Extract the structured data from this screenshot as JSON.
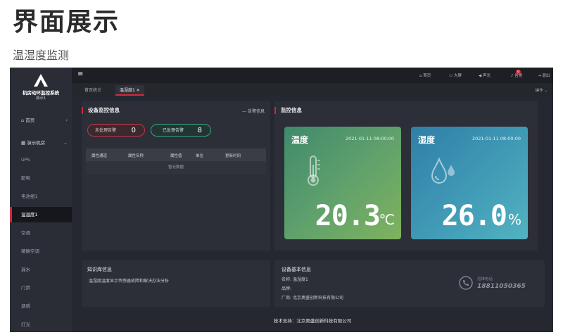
{
  "slide": {
    "title": "界面展示",
    "subtitle": "温湿度监测"
  },
  "app": {
    "name": "机房动环监控系统",
    "version": "演示1",
    "sidebar": [
      {
        "label": "首页"
      },
      {
        "label": "演示机房"
      },
      {
        "label": "UPS"
      },
      {
        "label": "配电"
      },
      {
        "label": "电池组1"
      },
      {
        "label": "温湿度1"
      },
      {
        "label": "空调"
      },
      {
        "label": "精确空调"
      },
      {
        "label": "漏水"
      },
      {
        "label": "门禁"
      },
      {
        "label": "烟感"
      },
      {
        "label": "灯光"
      }
    ],
    "topbar": {
      "home": "首页",
      "screen": "大屏",
      "sound": "声光",
      "alarm": "告警",
      "alarm_count": "0",
      "exit": "退出"
    },
    "tabs": [
      {
        "label": "首页统计"
      },
      {
        "label": "温湿度1"
      }
    ],
    "ops_label": "操作",
    "device_panel": {
      "title": "设备监控信息",
      "alarm_link": "告警信息",
      "unhandled_label": "未处理告警",
      "unhandled_count": "0",
      "handled_label": "已处理告警",
      "handled_count": "8",
      "columns": [
        "属性通道",
        "属性名称",
        "属性值",
        "单位",
        "更新时间"
      ],
      "empty_text": "暂无数据"
    },
    "monitor_panel": {
      "title": "监控信息",
      "temperature": {
        "label": "温度",
        "time": "2021-01-11 08:00:00",
        "value": "20.3",
        "unit": "℃"
      },
      "humidity": {
        "label": "湿度",
        "time": "2021-01-11 08:00:00",
        "value": "26.0",
        "unit": "%"
      }
    },
    "knowledge_panel": {
      "title": "知识库信息",
      "desc": "温湿度温度显示传感器故障和解决办法分析"
    },
    "basic_panel": {
      "title": "设备基本信息",
      "name_label": "名称:",
      "name_value": "温湿度1",
      "brand_label": "品牌:",
      "maker_label": "厂商:",
      "maker_value": "北京奥盛创新科技有限公司",
      "phone_label": "运维电话",
      "phone_value": "18811050365"
    },
    "footer": "技术支持：北京奥盛创新科技有限公司"
  }
}
